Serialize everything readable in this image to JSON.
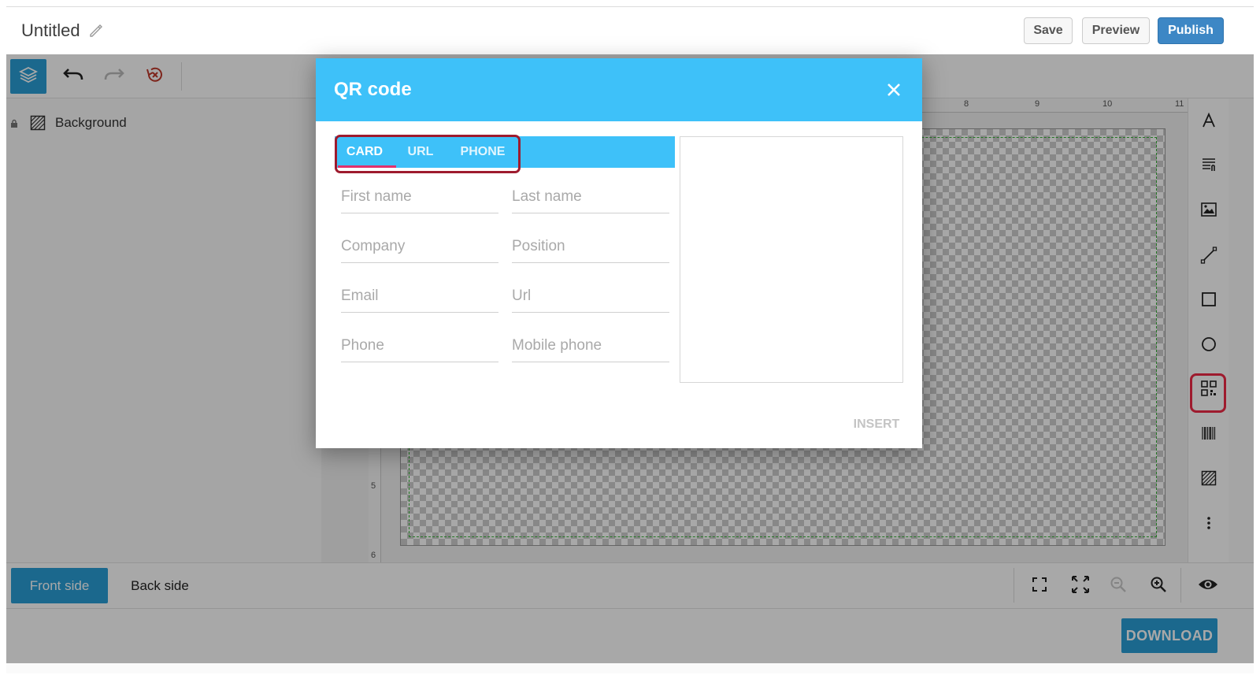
{
  "header": {
    "title": "Untitled",
    "save_label": "Save",
    "preview_label": "Preview",
    "publish_label": "Publish"
  },
  "layers": {
    "items": [
      {
        "name": "Background"
      }
    ]
  },
  "rulers": {
    "top_numbers": [
      "8",
      "9",
      "10",
      "11"
    ],
    "left_numbers": [
      "5",
      "6"
    ]
  },
  "sides": {
    "front_label": "Front side",
    "back_label": "Back side"
  },
  "footer": {
    "download_label": "DOWNLOAD"
  },
  "dialog": {
    "title": "QR code",
    "tabs": [
      {
        "label": "CARD",
        "active": true
      },
      {
        "label": "URL",
        "active": false
      },
      {
        "label": "PHONE",
        "active": false
      }
    ],
    "fields": {
      "first_name": {
        "placeholder": "First name",
        "value": ""
      },
      "last_name": {
        "placeholder": "Last name",
        "value": ""
      },
      "company": {
        "placeholder": "Company",
        "value": ""
      },
      "position": {
        "placeholder": "Position",
        "value": ""
      },
      "email": {
        "placeholder": "Email",
        "value": ""
      },
      "url": {
        "placeholder": "Url",
        "value": ""
      },
      "phone": {
        "placeholder": "Phone",
        "value": ""
      },
      "mobile_phone": {
        "placeholder": "Mobile phone",
        "value": ""
      }
    },
    "insert_label": "INSERT"
  },
  "tools": [
    "text-icon",
    "paragraph-icon",
    "image-icon",
    "line-icon",
    "rectangle-icon",
    "circle-icon",
    "qr-code-icon",
    "barcode-icon",
    "background-icon",
    "more-icon"
  ],
  "colors": {
    "accent": "#2a9fd6",
    "dialog_header": "#3ec1f9",
    "publish": "#3d87c5",
    "highlight": "#9e1b2e",
    "tab_indicator": "#e2306c",
    "safe_zone": "#36b336"
  }
}
